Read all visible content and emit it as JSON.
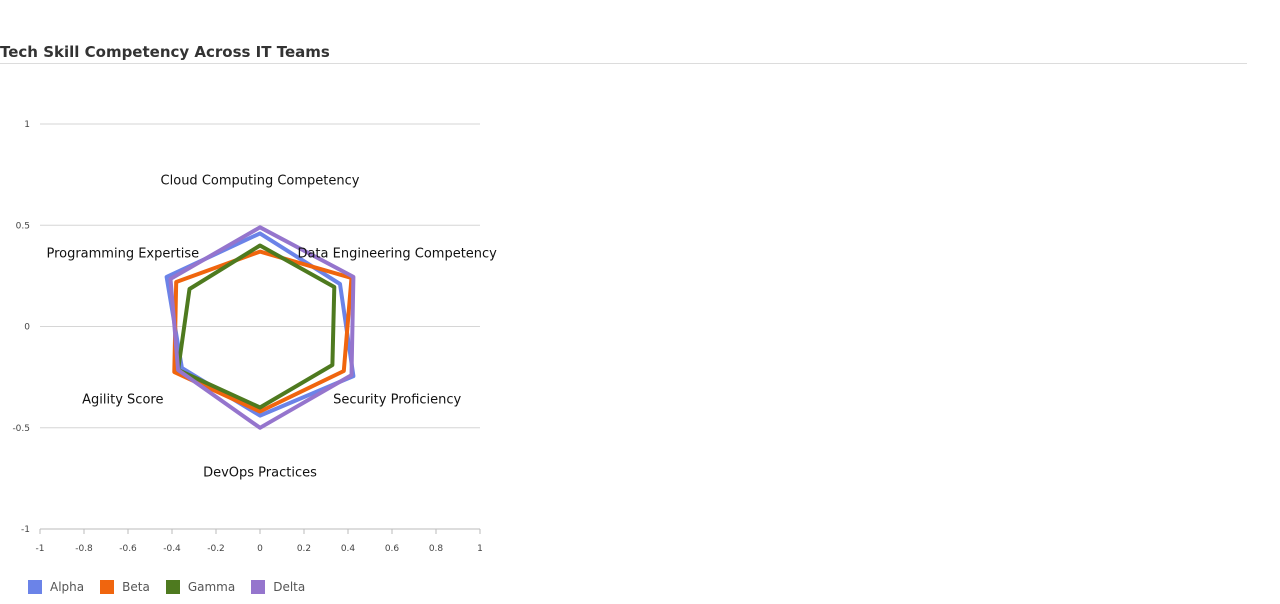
{
  "chart_data": {
    "type": "radar",
    "title": "Tech Skill Competency Across IT Teams",
    "axes": [
      "Cloud Computing Competency",
      "Data Engineering Competency",
      "Security Proficiency",
      "DevOps Practices",
      "Agility Score",
      "Programming Expertise"
    ],
    "series": [
      {
        "name": "Alpha",
        "color": "#6b83e8",
        "values": [
          0.46,
          0.42,
          0.49,
          0.44,
          0.41,
          0.49
        ]
      },
      {
        "name": "Beta",
        "color": "#f0650e",
        "values": [
          0.37,
          0.48,
          0.44,
          0.42,
          0.45,
          0.44
        ]
      },
      {
        "name": "Gamma",
        "color": "#4e7a1f",
        "values": [
          0.4,
          0.39,
          0.38,
          0.4,
          0.43,
          0.37
        ]
      },
      {
        "name": "Delta",
        "color": "#9575cd",
        "values": [
          0.49,
          0.49,
          0.48,
          0.5,
          0.43,
          0.47
        ]
      }
    ],
    "xlim": [
      -1,
      1
    ],
    "ylim": [
      -1,
      1
    ],
    "x_ticks": [
      "-1",
      "-0.8",
      "-0.6",
      "-0.4",
      "-0.2",
      "0",
      "0.2",
      "0.4",
      "0.6",
      "0.8",
      "1"
    ],
    "y_ticks": [
      "1",
      "0.5",
      "0",
      "-0.5",
      "-1"
    ],
    "grid": true,
    "legend_position": "bottom-left"
  }
}
